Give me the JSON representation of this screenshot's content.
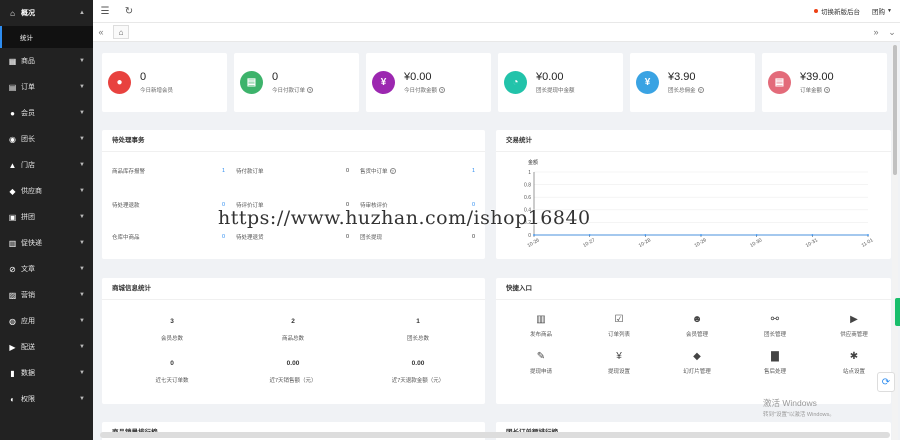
{
  "topbar": {
    "menu_icon": "menu-icon",
    "refresh_icon": "refresh-icon",
    "old_backend_link": "切换新版后台",
    "user_name": "团购"
  },
  "sidebar": {
    "items": [
      {
        "label": "概况",
        "icon": "home-icon"
      },
      {
        "label": "商品",
        "icon": "goods-icon"
      },
      {
        "label": "订单",
        "icon": "order-icon"
      },
      {
        "label": "会员",
        "icon": "member-icon"
      },
      {
        "label": "团长",
        "icon": "leader-icon"
      },
      {
        "label": "门店",
        "icon": "store-icon"
      },
      {
        "label": "供应商",
        "icon": "supplier-icon"
      },
      {
        "label": "拼团",
        "icon": "group-icon"
      },
      {
        "label": "促快递",
        "icon": "express-icon"
      },
      {
        "label": "文章",
        "icon": "article-icon"
      },
      {
        "label": "营销",
        "icon": "marketing-icon"
      },
      {
        "label": "应用",
        "icon": "app-icon"
      },
      {
        "label": "配送",
        "icon": "delivery-icon"
      },
      {
        "label": "数据",
        "icon": "data-icon"
      },
      {
        "label": "权限",
        "icon": "permission-icon"
      }
    ],
    "sub_item": "统计"
  },
  "stats": [
    {
      "value": "0",
      "label": "今日新增会员",
      "color": "#e8423f",
      "has_help": false
    },
    {
      "value": "0",
      "label": "今日付款订单",
      "color": "#3db36b",
      "has_help": true
    },
    {
      "value": "¥0.00",
      "label": "今日付款金额",
      "color": "#9c27b0",
      "has_help": true
    },
    {
      "value": "¥0.00",
      "label": "团长提现中金额",
      "color": "#22c3aa",
      "has_help": false
    },
    {
      "value": "¥3.90",
      "label": "团长总佣金",
      "color": "#3aa3e3",
      "has_help": true
    },
    {
      "value": "¥39.00",
      "label": "订单金额",
      "color": "#e36b7a",
      "has_help": true
    }
  ],
  "pending": {
    "title": "待处理事务",
    "rows": [
      [
        {
          "label": "商品库存报警",
          "value": "1",
          "blue": true
        },
        {
          "label": "待付款订单",
          "value": "0",
          "blue": false
        },
        {
          "label": "售货中订单",
          "value": "1",
          "blue": true,
          "help": true
        }
      ],
      [
        {
          "label": "待处理退款",
          "value": "0",
          "blue": true
        },
        {
          "label": "待评价订单",
          "value": "0",
          "blue": false
        },
        {
          "label": "待审核评价",
          "value": "0",
          "blue": true
        }
      ],
      [
        {
          "label": "仓库中商品",
          "value": "0",
          "blue": true
        },
        {
          "label": "待处理退货",
          "value": "0",
          "blue": false
        },
        {
          "label": "团长提现",
          "value": "0",
          "blue": false
        }
      ]
    ]
  },
  "trade": {
    "title": "交易统计"
  },
  "chart_data": {
    "type": "line",
    "ylabel": "金额",
    "ylim": [
      0,
      1
    ],
    "yticks": [
      "0",
      "0.2",
      "0.4",
      "0.6",
      "0.8",
      "1"
    ],
    "categories": [
      "10-26",
      "10-27",
      "10-28",
      "10-29",
      "10-30",
      "10-31",
      "11-01"
    ],
    "series": [
      {
        "values": [
          0,
          0,
          0,
          0,
          0,
          0,
          0
        ]
      }
    ],
    "grid": true
  },
  "mall_info": {
    "title": "商城信息统计",
    "cells": [
      {
        "value": "3",
        "label": "会员总数"
      },
      {
        "value": "2",
        "label": "商品总数"
      },
      {
        "value": "1",
        "label": "团长总数"
      },
      {
        "value": "0",
        "label": "近七天订单数"
      },
      {
        "value": "0.00",
        "label": "近7天销售额（元）"
      },
      {
        "value": "0.00",
        "label": "近7天退款金额（元）"
      }
    ]
  },
  "quick": {
    "title": "快捷入口",
    "items": [
      {
        "label": "发布商品",
        "icon": "barcode-icon"
      },
      {
        "label": "订单列表",
        "icon": "clipboard-icon"
      },
      {
        "label": "会员管理",
        "icon": "user-icon"
      },
      {
        "label": "团长管理",
        "icon": "org-icon"
      },
      {
        "label": "供应商管理",
        "icon": "truck-icon"
      },
      {
        "label": "提现申请",
        "icon": "tag-icon"
      },
      {
        "label": "提现设置",
        "icon": "yen-icon"
      },
      {
        "label": "幻灯片管理",
        "icon": "label-icon"
      },
      {
        "label": "售后处理",
        "icon": "bar-chart-icon"
      },
      {
        "label": "站点设置",
        "icon": "settings-icon"
      }
    ]
  },
  "bottom_titles": [
    "商品销量排行榜",
    "团长订单额排行榜"
  ],
  "watermark": "https://www.huzhan.com/ishop16840",
  "windows_activation": {
    "line1": "激活 Windows",
    "line2": "转到\"设置\"以激活 Windows。"
  }
}
